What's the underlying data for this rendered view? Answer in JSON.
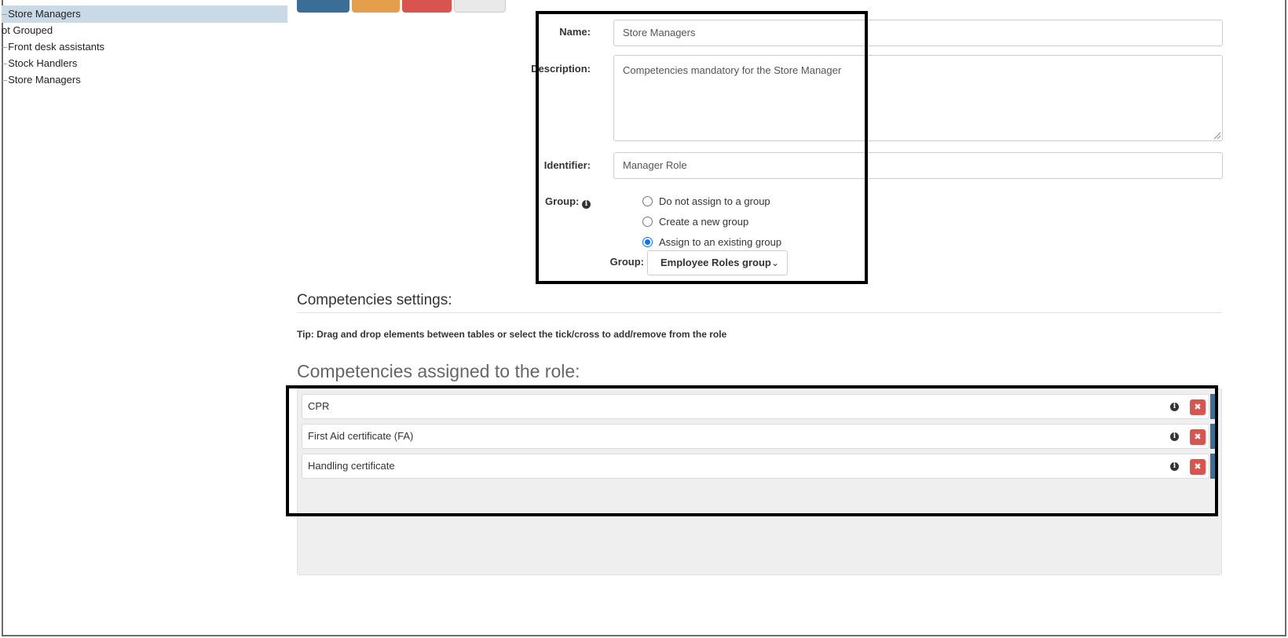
{
  "tree": {
    "items": [
      {
        "label": "Store Managers",
        "selected": true
      },
      {
        "label": "ot Grouped",
        "selected": false
      },
      {
        "label": "Front desk assistants",
        "selected": false
      },
      {
        "label": "Stock Handlers",
        "selected": false
      },
      {
        "label": "Store Managers",
        "selected": false
      }
    ]
  },
  "toolbar": {
    "colors": [
      "#3b6e96",
      "#e59e4a",
      "#d9534f",
      "#e9e9e9"
    ]
  },
  "form": {
    "name_label": "Name:",
    "name_value": "Store Managers",
    "description_label": "Description:",
    "description_value": "Competencies mandatory for the Store Manager",
    "identifier_label": "Identifier:",
    "identifier_value": "Manager Role",
    "group_label": "Group:",
    "group_info_icon": "i",
    "options": [
      {
        "label": "Do not assign to a group",
        "checked": false
      },
      {
        "label": "Create a new group",
        "checked": false
      },
      {
        "label": "Assign to an existing group",
        "checked": true
      }
    ],
    "group_select_label": "Group:",
    "group_select_value": "Employee Roles group",
    "select_chevron": "⌄"
  },
  "competencies": {
    "settings_title": "Competencies settings:",
    "tip": "Tip: Drag and drop elements between tables or select the tick/cross to add/remove from the role",
    "assigned_title": "Competencies assigned to the role:",
    "items": [
      {
        "label": "CPR"
      },
      {
        "label": "First Aid certificate (FA)"
      },
      {
        "label": "Handling certificate"
      }
    ],
    "info_icon": "i",
    "remove_icon": "✖"
  }
}
